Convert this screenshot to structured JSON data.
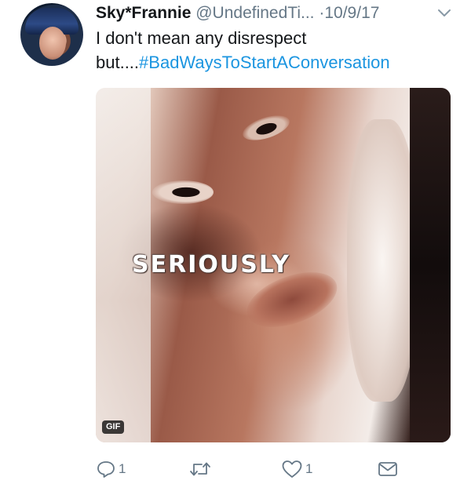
{
  "tweet": {
    "display_name": "Sky*Frannie",
    "handle": "@UndefinedTi...",
    "separator": "·",
    "date": "10/9/17",
    "text_prefix": "I don't mean any disrespect but....",
    "hashtag": "#BadWaysToStartAConversation",
    "media": {
      "overlay_text": "SERIOUSLY",
      "badge": "GIF"
    },
    "actions": {
      "reply_count": "1",
      "retweet_count": "",
      "like_count": "1"
    }
  },
  "colors": {
    "text": "#14171a",
    "secondary": "#657786",
    "link": "#1b95e0"
  },
  "icons": [
    "chevron-down-icon",
    "reply-icon",
    "retweet-icon",
    "like-icon",
    "direct-message-icon"
  ]
}
